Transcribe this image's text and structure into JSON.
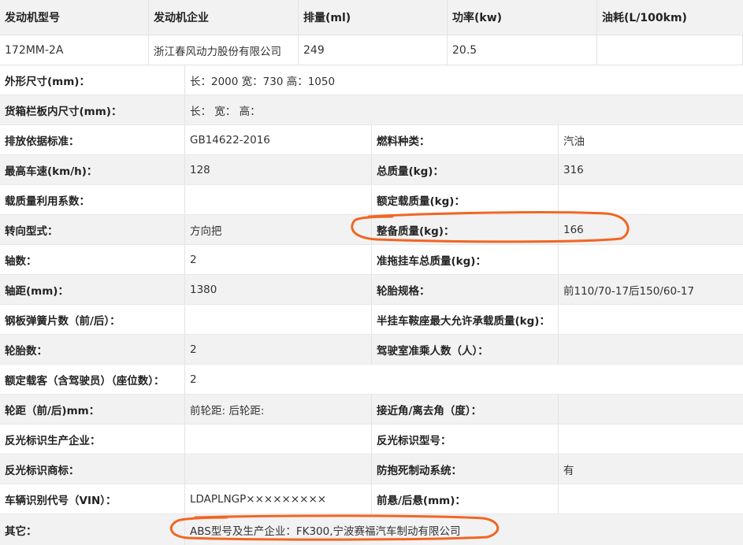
{
  "engine": {
    "headers": [
      "发动机型号",
      "发动机企业",
      "排量(ml)",
      "功率(kw)",
      "油耗(L/100km)"
    ],
    "values": [
      "172MM-2A",
      "浙江春风动力股份有限公司",
      "249",
      "20.5",
      ""
    ]
  },
  "specs": {
    "dimensions": {
      "label": "外形尺寸(mm)：",
      "value": "长：2000 宽：730 高：1050"
    },
    "cargo_box": {
      "label": "货箱栏板内尺寸(mm)：",
      "value": "长：  宽：  高："
    },
    "emission_std": {
      "label": "排放依据标准：",
      "value": "GB14622-2016"
    },
    "fuel_type": {
      "label": "燃料种类：",
      "value": "汽油"
    },
    "max_speed": {
      "label": "最高车速(km/h)：",
      "value": "128"
    },
    "total_mass": {
      "label": "总质量(kg)：",
      "value": "316"
    },
    "load_coef": {
      "label": "载质量利用系数：",
      "value": ""
    },
    "rated_load": {
      "label": "额定载质量(kg)：",
      "value": ""
    },
    "steering": {
      "label": "转向型式：",
      "value": "方向把"
    },
    "curb_mass": {
      "label": "整备质量(kg)：",
      "value": "166"
    },
    "axles": {
      "label": "轴数：",
      "value": "2"
    },
    "trailer_mass": {
      "label": "准拖挂车总质量(kg)：",
      "value": ""
    },
    "wheelbase": {
      "label": "轴距(mm)：",
      "value": "1380"
    },
    "tire_spec": {
      "label": "轮胎规格：",
      "value": "前110/70-17后150/60-17"
    },
    "leaf_springs": {
      "label": "钢板弹簧片数（前/后）：",
      "value": ""
    },
    "saddle_load": {
      "label": "半挂车鞍座最大允许承载质量(kg)：",
      "value": ""
    },
    "tires": {
      "label": "轮胎数：",
      "value": "2"
    },
    "cab_passengers": {
      "label": "驾驶室准乘人数（人）：",
      "value": ""
    },
    "seats": {
      "label": "额定载客（含驾驶员）（座位数）：",
      "value": "2"
    },
    "track": {
      "label": "轮距（前/后)mm：",
      "value": "前轮距: 后轮距:"
    },
    "angles": {
      "label": "接近角/离去角（度）：",
      "value": ""
    },
    "reflector_maker": {
      "label": "反光标识生产企业：",
      "value": ""
    },
    "reflector_model": {
      "label": "反光标识型号：",
      "value": ""
    },
    "reflector_brand": {
      "label": "反光标识商标：",
      "value": ""
    },
    "abs": {
      "label": "防抱死制动系统：",
      "value": "有"
    },
    "vin": {
      "label": "车辆识别代号（VIN）：",
      "value": "LDAPLNGP×××××××××"
    },
    "overhang": {
      "label": "前悬/后悬(mm)：",
      "value": ""
    },
    "other": {
      "label": "其它：",
      "value": "ABS型号及生产企业：FK300,宁波赛福汽车制动有限公司"
    }
  },
  "colors": {
    "highlight_circle": "#f26522",
    "label_bg": "#f2f2f2"
  }
}
